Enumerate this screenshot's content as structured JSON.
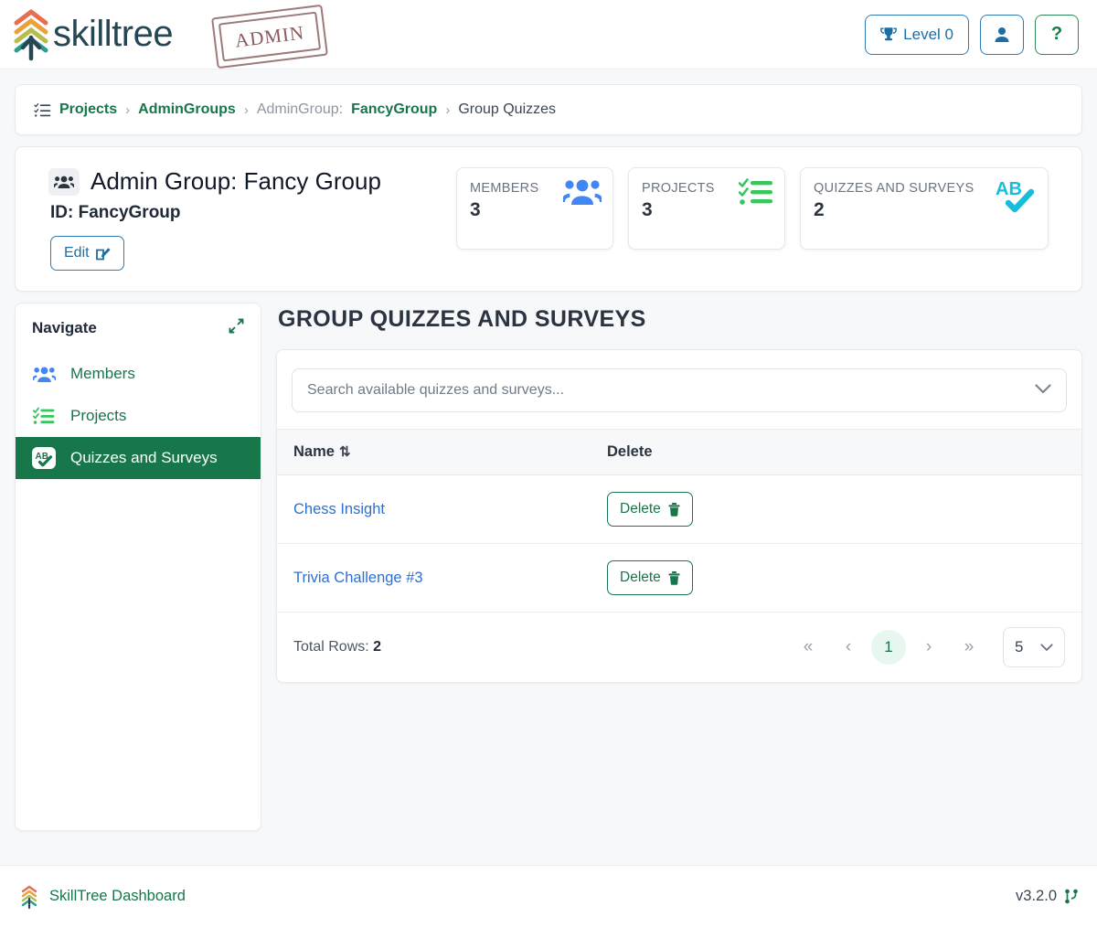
{
  "header": {
    "brand_name": "skilltree",
    "stamp_text": "ADMIN",
    "logo_icon": "skilltree-chevron-logo",
    "level_label": "Level 0",
    "level_icon": "trophy-icon",
    "user_icon": "user-icon",
    "help_icon": "question-mark-icon"
  },
  "breadcrumb": {
    "icon": "list-check-icon",
    "items": [
      {
        "label": "Projects",
        "type": "link"
      },
      {
        "label": "AdminGroups",
        "type": "link"
      },
      {
        "label": "AdminGroup:",
        "type": "muted"
      },
      {
        "label": "FancyGroup",
        "type": "link"
      },
      {
        "label": "Group Quizzes",
        "type": "current"
      }
    ],
    "separator": "›"
  },
  "page_header": {
    "icon": "users-group-icon",
    "title": "Admin Group: Fancy Group",
    "id_text": "ID: FancyGroup",
    "edit_label": "Edit",
    "edit_icon": "pencil-square-icon",
    "stats": [
      {
        "label": "MEMBERS",
        "value": "3",
        "icon": "users-icon",
        "color": "#4285f4"
      },
      {
        "label": "PROJECTS",
        "value": "3",
        "icon": "tasks-checklist-icon",
        "color": "#34c759"
      },
      {
        "label": "QUIZZES AND SURVEYS",
        "value": "2",
        "icon": "ab-check-icon",
        "color": "#17bedb"
      }
    ]
  },
  "sidebar": {
    "title": "Navigate",
    "collapse_icon": "compress-arrows-icon",
    "items": [
      {
        "label": "Members",
        "icon": "users-icon",
        "active": false
      },
      {
        "label": "Projects",
        "icon": "tasks-checklist-icon",
        "active": false
      },
      {
        "label": "Quizzes and Surveys",
        "icon": "ab-check-icon",
        "active": true
      }
    ]
  },
  "main": {
    "title": "GROUP QUIZZES AND SURVEYS",
    "search": {
      "placeholder": "Search available quizzes and surveys...",
      "value": "",
      "chevron_icon": "chevron-down-icon"
    },
    "table": {
      "columns": [
        {
          "label": "Name",
          "sortable": true,
          "sort_icon": "sort-updown-icon"
        },
        {
          "label": "Delete",
          "sortable": false
        }
      ],
      "rows": [
        {
          "name": "Chess Insight",
          "delete_label": "Delete",
          "delete_icon": "trash-icon"
        },
        {
          "name": "Trivia Challenge #3",
          "delete_label": "Delete",
          "delete_icon": "trash-icon"
        }
      ]
    },
    "footer": {
      "total_rows_label": "Total Rows:",
      "total_rows_value": "2",
      "pager": {
        "first_icon": "«",
        "prev_icon": "‹",
        "next_icon": "›",
        "last_icon": "»",
        "pages": [
          "1"
        ],
        "active_page": "1"
      },
      "page_size": "5",
      "page_size_icon": "chevron-down-icon"
    }
  },
  "footer": {
    "logo_icon": "skilltree-chevron-logo-small",
    "dashboard_label": "SkillTree Dashboard",
    "version": "v3.2.0",
    "version_icon": "code-branch-icon"
  },
  "colors": {
    "brand_green": "#17764a",
    "link_blue": "#2f6fd0",
    "accent_blue": "#1c6ea4",
    "page_bg": "#f7f8fa"
  }
}
